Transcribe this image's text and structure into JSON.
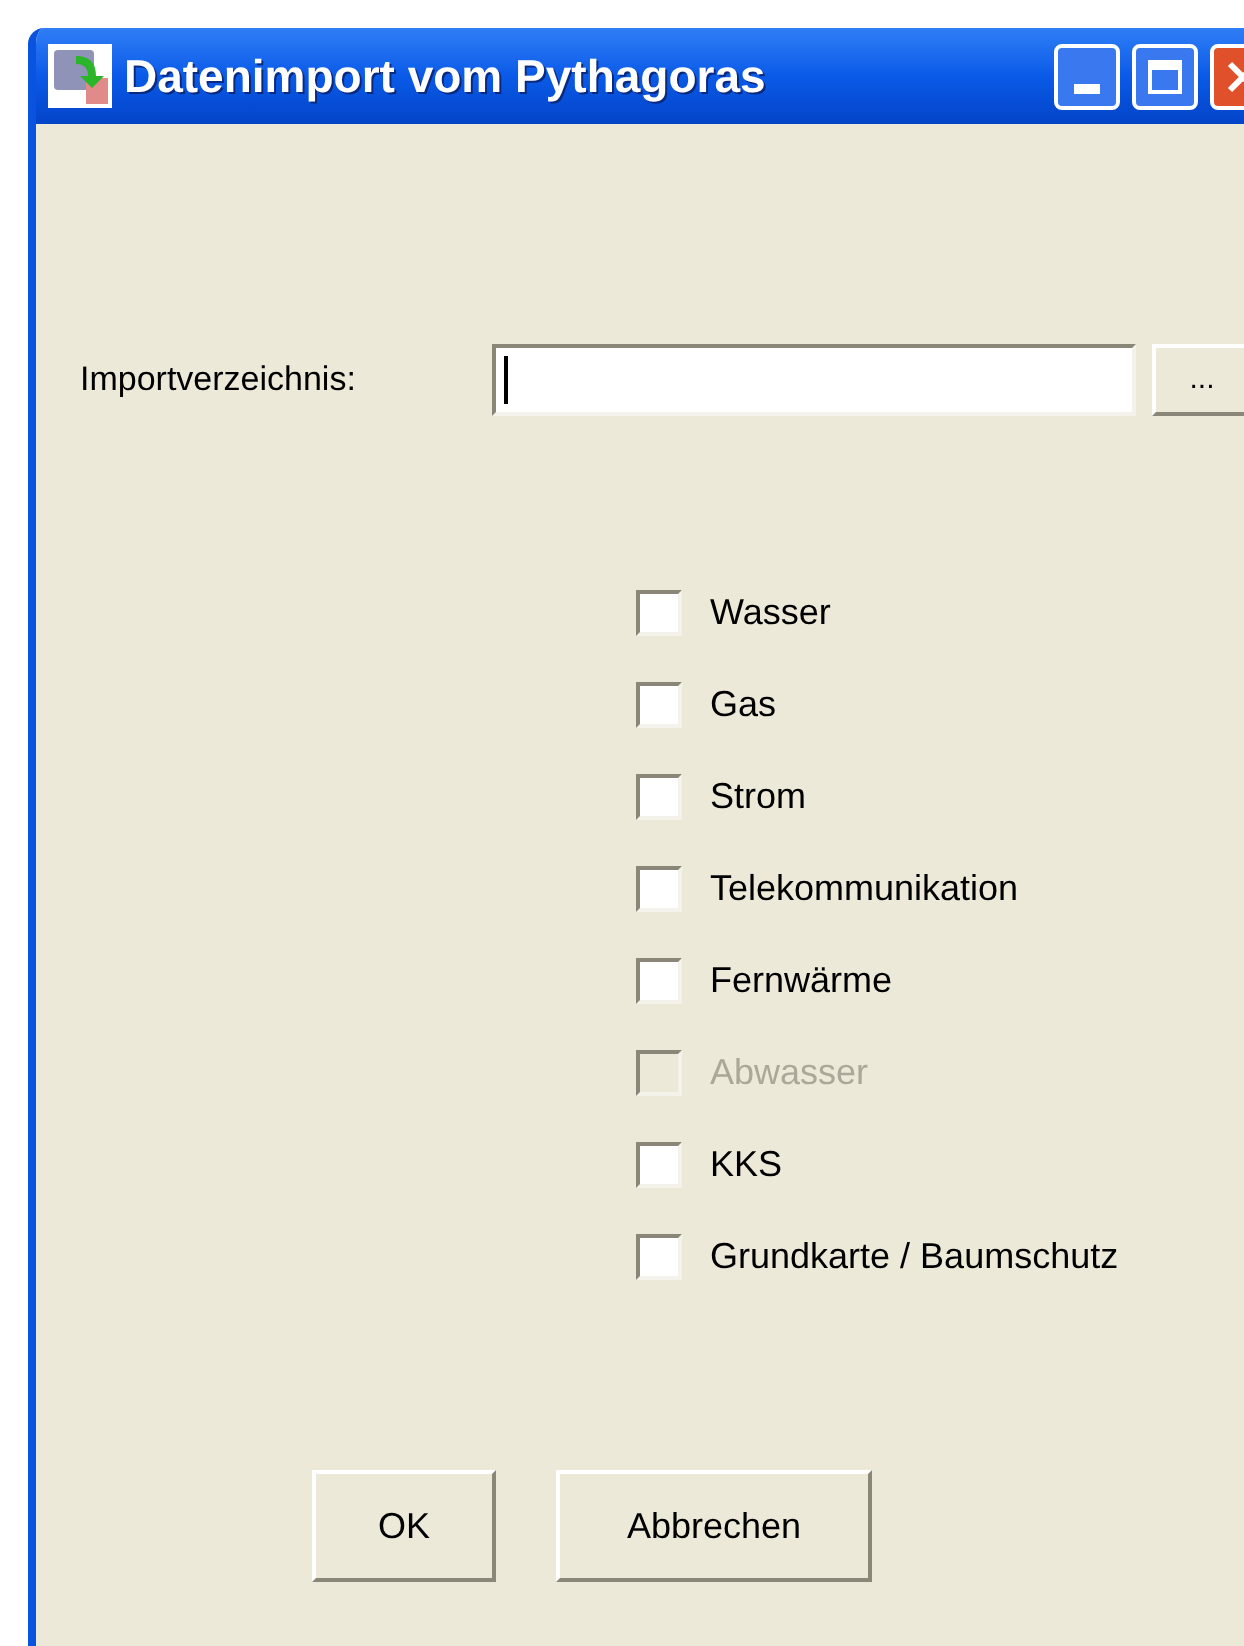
{
  "window": {
    "title": "Datenimport vom Pythagoras"
  },
  "import_directory": {
    "label": "Importverzeichnis:",
    "browse_button": "..."
  },
  "options": [
    {
      "label": "Wasser",
      "checked": false,
      "disabled": false
    },
    {
      "label": "Gas",
      "checked": false,
      "disabled": false
    },
    {
      "label": "Strom",
      "checked": false,
      "disabled": false
    },
    {
      "label": "Telekommunikation",
      "checked": false,
      "disabled": false
    },
    {
      "label": "Fernwärme",
      "checked": false,
      "disabled": false
    },
    {
      "label": "Abwasser",
      "checked": false,
      "disabled": true
    },
    {
      "label": "KKS",
      "checked": false,
      "disabled": false
    },
    {
      "label": "Grundkarte / Baumschutz",
      "checked": false,
      "disabled": false
    }
  ],
  "buttons": [
    "OK",
    "Abbrechen"
  ]
}
